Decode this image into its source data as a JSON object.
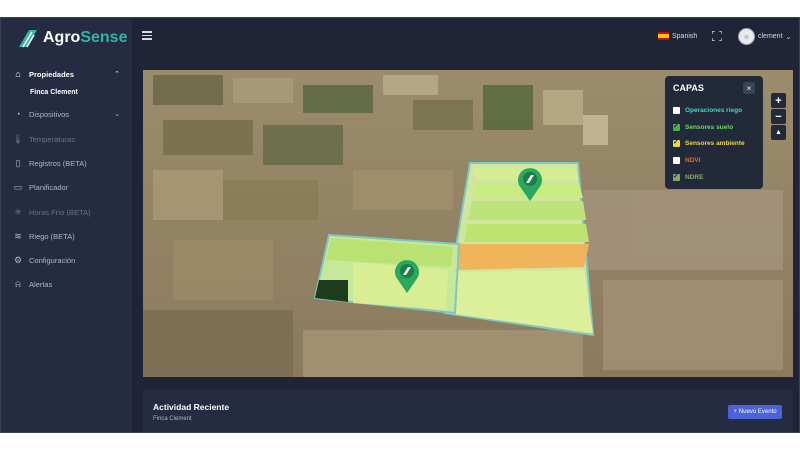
{
  "brand": {
    "name_part1": "Agro",
    "name_part2": "Sense"
  },
  "sidebar": {
    "items": [
      {
        "label": "Propiedades",
        "icon": "home-icon",
        "state": "active"
      },
      {
        "label": "Dispositivos",
        "icon": "devices-icon",
        "state": "normal"
      },
      {
        "label": "Temperaturas",
        "icon": "thermometer-icon",
        "state": "muted"
      },
      {
        "label": "Registros (BETA)",
        "icon": "book-icon",
        "state": "normal"
      },
      {
        "label": "Planificador",
        "icon": "calendar-icon",
        "state": "normal"
      },
      {
        "label": "Horas Frío (BETA)",
        "icon": "snowflake-icon",
        "state": "muted"
      },
      {
        "label": "Riego (BETA)",
        "icon": "irrigation-icon",
        "state": "normal"
      },
      {
        "label": "Configuración",
        "icon": "gear-icon",
        "state": "normal"
      },
      {
        "label": "Alertas",
        "icon": "bell-icon",
        "state": "normal"
      }
    ],
    "subitem": "Finca Clement"
  },
  "topbar": {
    "language": "Spanish",
    "user": "clement"
  },
  "layers": {
    "title": "CAPAS",
    "close": "×",
    "items": [
      {
        "label": "Operaciones riego",
        "checked": false,
        "color": "#3fd6c8"
      },
      {
        "label": "Sensores suelo",
        "checked": true,
        "color": "#6fd66a"
      },
      {
        "label": "Sensores ambiente",
        "checked": true,
        "color": "#e7d94a"
      },
      {
        "label": "NDVI",
        "checked": false,
        "color": "#e8672d"
      },
      {
        "label": "NDRE",
        "checked": true,
        "color": "#8ca46a"
      }
    ]
  },
  "map_controls": {
    "zoom_in": "+",
    "zoom_out": "−",
    "compass": "▲"
  },
  "activity": {
    "title": "Actividad Reciente",
    "subtitle": "Finca Clement",
    "button_icon": "+",
    "button": "Nuevo Evento"
  },
  "colors": {
    "sidebar_bg": "#252c41",
    "main_bg": "#1f2537",
    "accent": "#34b3a7",
    "button": "#4a63d8",
    "pin": "#2aa85f"
  }
}
